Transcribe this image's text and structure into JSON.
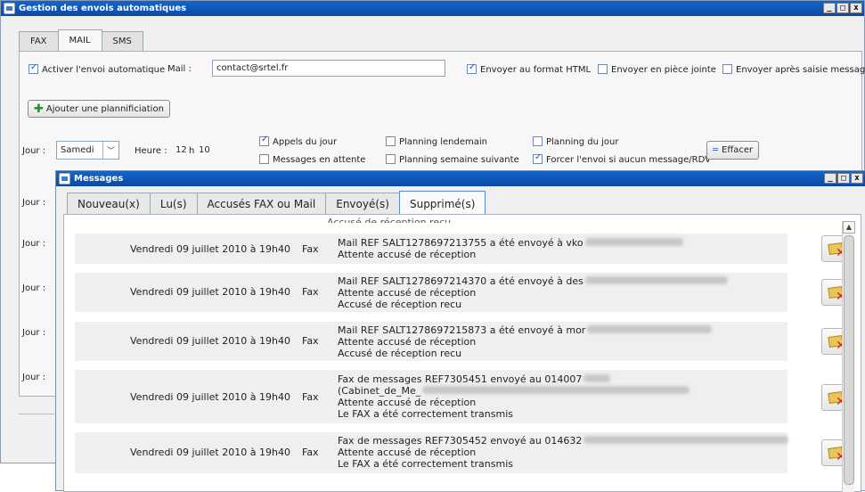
{
  "outer": {
    "title": "Gestion des envois automatiques",
    "window_controls": [
      "_",
      "□",
      "x"
    ],
    "tabs": [
      {
        "label": "FAX",
        "active": false
      },
      {
        "label": "MAIL",
        "active": true
      },
      {
        "label": "SMS",
        "active": false
      }
    ],
    "activate_auto_label": "Activer l'envoi automatique",
    "activate_auto_checked": true,
    "mail_label": "Mail :",
    "mail_value": "contact@srtel.fr",
    "html_format_label": "Envoyer au format HTML",
    "html_format_checked": true,
    "attachment_label": "Envoyer en pièce jointe",
    "attachment_checked": false,
    "after_message_label": "Envoyer après saisie message",
    "after_message_checked": false,
    "add_planning_label": "Ajouter une plannificiation",
    "schedule": {
      "jour_label": "Jour :",
      "day_value": "Samedi",
      "heure_label": "Heure :",
      "hour": "12",
      "h_sep": "h",
      "minute": "10",
      "options": [
        {
          "label": "Appels du jour",
          "checked": true
        },
        {
          "label": "Messages en attente",
          "checked": false
        },
        {
          "label": "Planning lendemain",
          "checked": false
        },
        {
          "label": "Planning semaine suivante",
          "checked": false
        },
        {
          "label": "Planning du jour",
          "checked": false
        },
        {
          "label": "Forcer l'envoi si aucun message/RDV",
          "checked": true
        }
      ],
      "clear_label": "Effacer"
    },
    "side_jour_labels": [
      "Jour :",
      "Jour :",
      "Jour :",
      "Jour :",
      "Jour :"
    ]
  },
  "messages": {
    "title": "Messages",
    "window_controls": [
      "_",
      "□",
      "x"
    ],
    "tabs": [
      {
        "label": "Nouveau(x)",
        "active": false
      },
      {
        "label": "Lu(s)",
        "active": false
      },
      {
        "label": "Accusés FAX ou Mail",
        "active": false
      },
      {
        "label": "Envoyé(s)",
        "active": false
      },
      {
        "label": "Supprimé(s)",
        "active": true
      }
    ],
    "cut_text": "Accusé de réception recu",
    "rows": [
      {
        "date": "Vendredi 09 juillet 2010 à 19h40",
        "type": "Fax",
        "lines": [
          "Mail REF SALT1278697213755 a été envoyé à vko",
          "Attente accusé de réception"
        ]
      },
      {
        "date": "Vendredi 09 juillet 2010 à 19h40",
        "type": "Fax",
        "lines": [
          "Mail REF SALT1278697214370 a été envoyé à des",
          "Attente accusé de réception",
          "Accusé de réception recu"
        ]
      },
      {
        "date": "Vendredi 09 juillet 2010 à 19h40",
        "type": "Fax",
        "lines": [
          "Mail REF SALT1278697215873 a été envoyé à mor",
          "Attente accusé de réception",
          "Accusé de réception recu"
        ]
      },
      {
        "date": "Vendredi 09 juillet 2010 à 19h40",
        "type": "Fax",
        "lines": [
          "Fax de messages REF7305451 envoyé au 014007",
          "(Cabinet_de_Me_",
          "Attente accusé de réception",
          "Le FAX a été correctement transmis"
        ]
      },
      {
        "date": "Vendredi 09 juillet 2010 à 19h40",
        "type": "Fax",
        "lines": [
          "Fax de messages REF7305452 envoyé au 014632",
          "Attente accusé de réception",
          "Le FAX a été correctement transmis"
        ]
      }
    ]
  }
}
